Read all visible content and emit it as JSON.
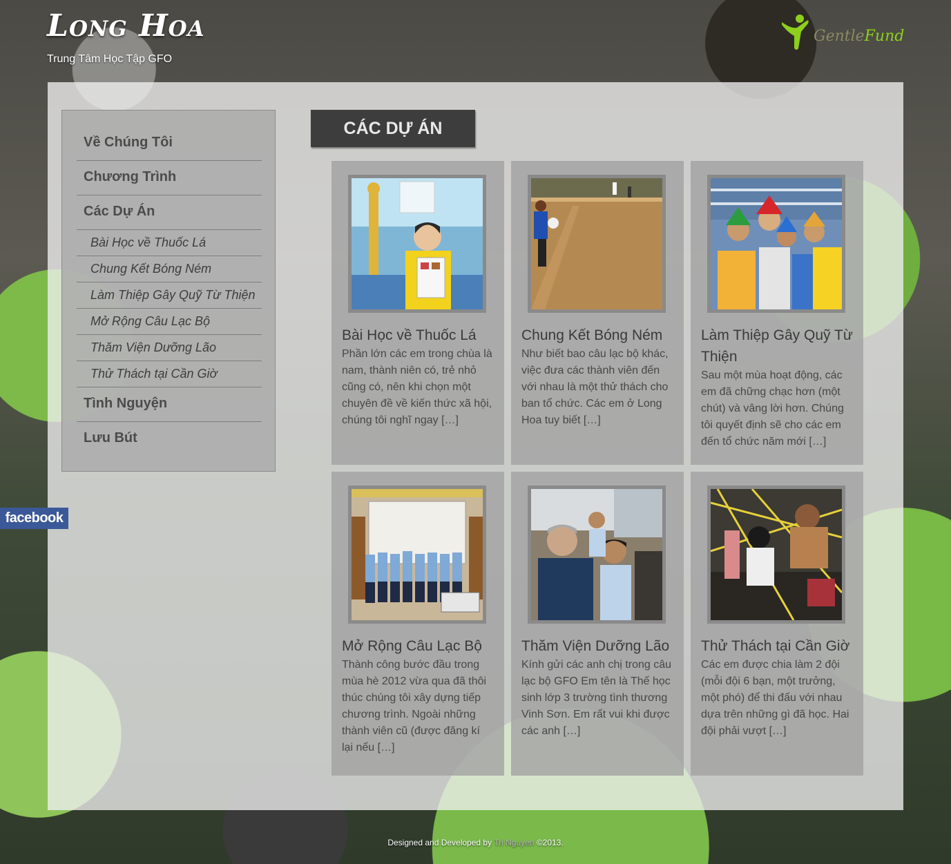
{
  "header": {
    "site_title": "Long Hoa",
    "subtitle": "Trung Tâm Học Tập GFO",
    "brand_text_a": "Gentle",
    "brand_text_b": "Fund"
  },
  "sidebar": {
    "items": [
      {
        "label": "Về Chúng Tôi"
      },
      {
        "label": "Chương Trình"
      },
      {
        "label": "Các Dự Án"
      },
      {
        "label": "Bài Học về Thuốc Lá"
      },
      {
        "label": "Chung Kết Bóng Ném"
      },
      {
        "label": "Làm Thiệp Gây Quỹ Từ Thiện"
      },
      {
        "label": "Mở Rộng Câu Lạc Bộ"
      },
      {
        "label": "Thăm Viện Dưỡng Lão"
      },
      {
        "label": "Thử Thách tại Cần Giờ"
      },
      {
        "label": "Tình Nguyện"
      },
      {
        "label": "Lưu Bút"
      }
    ]
  },
  "facebook_tab": "facebook",
  "section_title": "CÁC DỰ ÁN",
  "projects": [
    {
      "title": "Bài Học về Thuốc Lá",
      "excerpt": "Phần lớn các em trong chùa là nam, thành niên có, trẻ nhỏ cũng có, nên khi chọn một chuyên đề về kiến thức xã hội, chúng tôi nghĩ ngay […]"
    },
    {
      "title": "Chung Kết Bóng Ném",
      "excerpt": "Như biết bao câu lạc bộ khác, việc đưa các thành viên đến với nhau là một thử thách cho ban tổ chức. Các em ở Long Hoa tuy biết […]"
    },
    {
      "title": "Làm Thiệp Gây Quỹ Từ Thiện",
      "excerpt": "Sau một mùa hoạt động, các em đã chững chạc hơn (một chút) và vâng lời hơn. Chúng tôi quyết định sẽ cho các em đến tổ chức năm mới […]"
    },
    {
      "title": "Mở Rộng Câu Lạc Bộ",
      "excerpt": "Thành công bước đầu trong mùa hè 2012 vừa qua đã thôi thúc chúng tôi xây dựng tiếp chương trình. Ngoài những thành viên cũ (được đăng kí lại nếu […]"
    },
    {
      "title": "Thăm Viện Dưỡng Lão",
      "excerpt": "Kính gửi các anh chị trong câu lạc bộ GFO Em tên là Thế học sinh lớp 3 trường tình thương Vinh Sơn. Em rất vui khi được các anh […]"
    },
    {
      "title": "Thử Thách tại Cần Giờ",
      "excerpt": "Các em được chia làm 2 đội (mỗi đội 6 bạn, một trưởng, một phó) để thi đấu với nhau dựa trên những gì đã học. Hai đội phải vượt […]"
    }
  ],
  "footer": {
    "prefix": "Designed and Developed by",
    "author": "Tri Nguyen",
    "suffix": "©2013."
  },
  "colors": {
    "facebook_blue": "#3b5998",
    "brand_green": "#8ccf1d",
    "title_bar": "#3d3d3d"
  }
}
